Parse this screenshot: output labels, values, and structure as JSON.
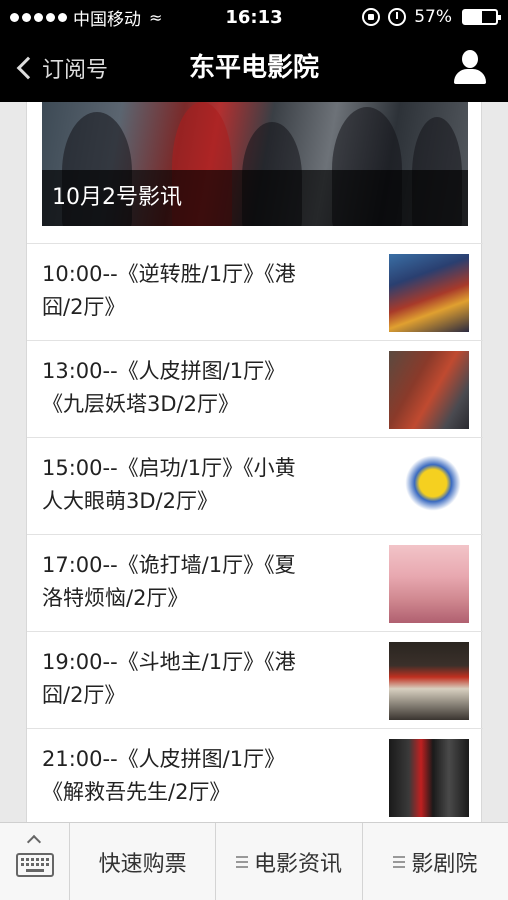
{
  "status_bar": {
    "carrier": "中国移动",
    "time": "16:13",
    "battery": "57%",
    "battery_level": 0.57
  },
  "nav": {
    "back_label": "订阅号",
    "title": "东平电影院"
  },
  "banner": {
    "caption": "10月2号影讯"
  },
  "schedule": [
    {
      "line1": "10:00--《逆转胜/1厅》《港",
      "line2": "囧/2厅》"
    },
    {
      "line1": "13:00--《人皮拼图/1厅》",
      "line2": "《九层妖塔3D/2厅》"
    },
    {
      "line1": "15:00--《启功/1厅》《小黄",
      "line2": "人大眼萌3D/2厅》"
    },
    {
      "line1": "17:00--《诡打墙/1厅》《夏",
      "line2": "洛特烦恼/2厅》"
    },
    {
      "line1": "19:00--《斗地主/1厅》《港",
      "line2": "囧/2厅》"
    },
    {
      "line1": "21:00--《人皮拼图/1厅》",
      "line2": "《解救吾先生/2厅》"
    }
  ],
  "bottom_menu": {
    "item1": "快速购票",
    "item2": "电影资讯",
    "item3": "影剧院"
  },
  "icons": {
    "back": "chevron-left-icon",
    "profile": "user-icon",
    "keyboard": "keyboard-icon",
    "menu": "hamburger-icon"
  }
}
